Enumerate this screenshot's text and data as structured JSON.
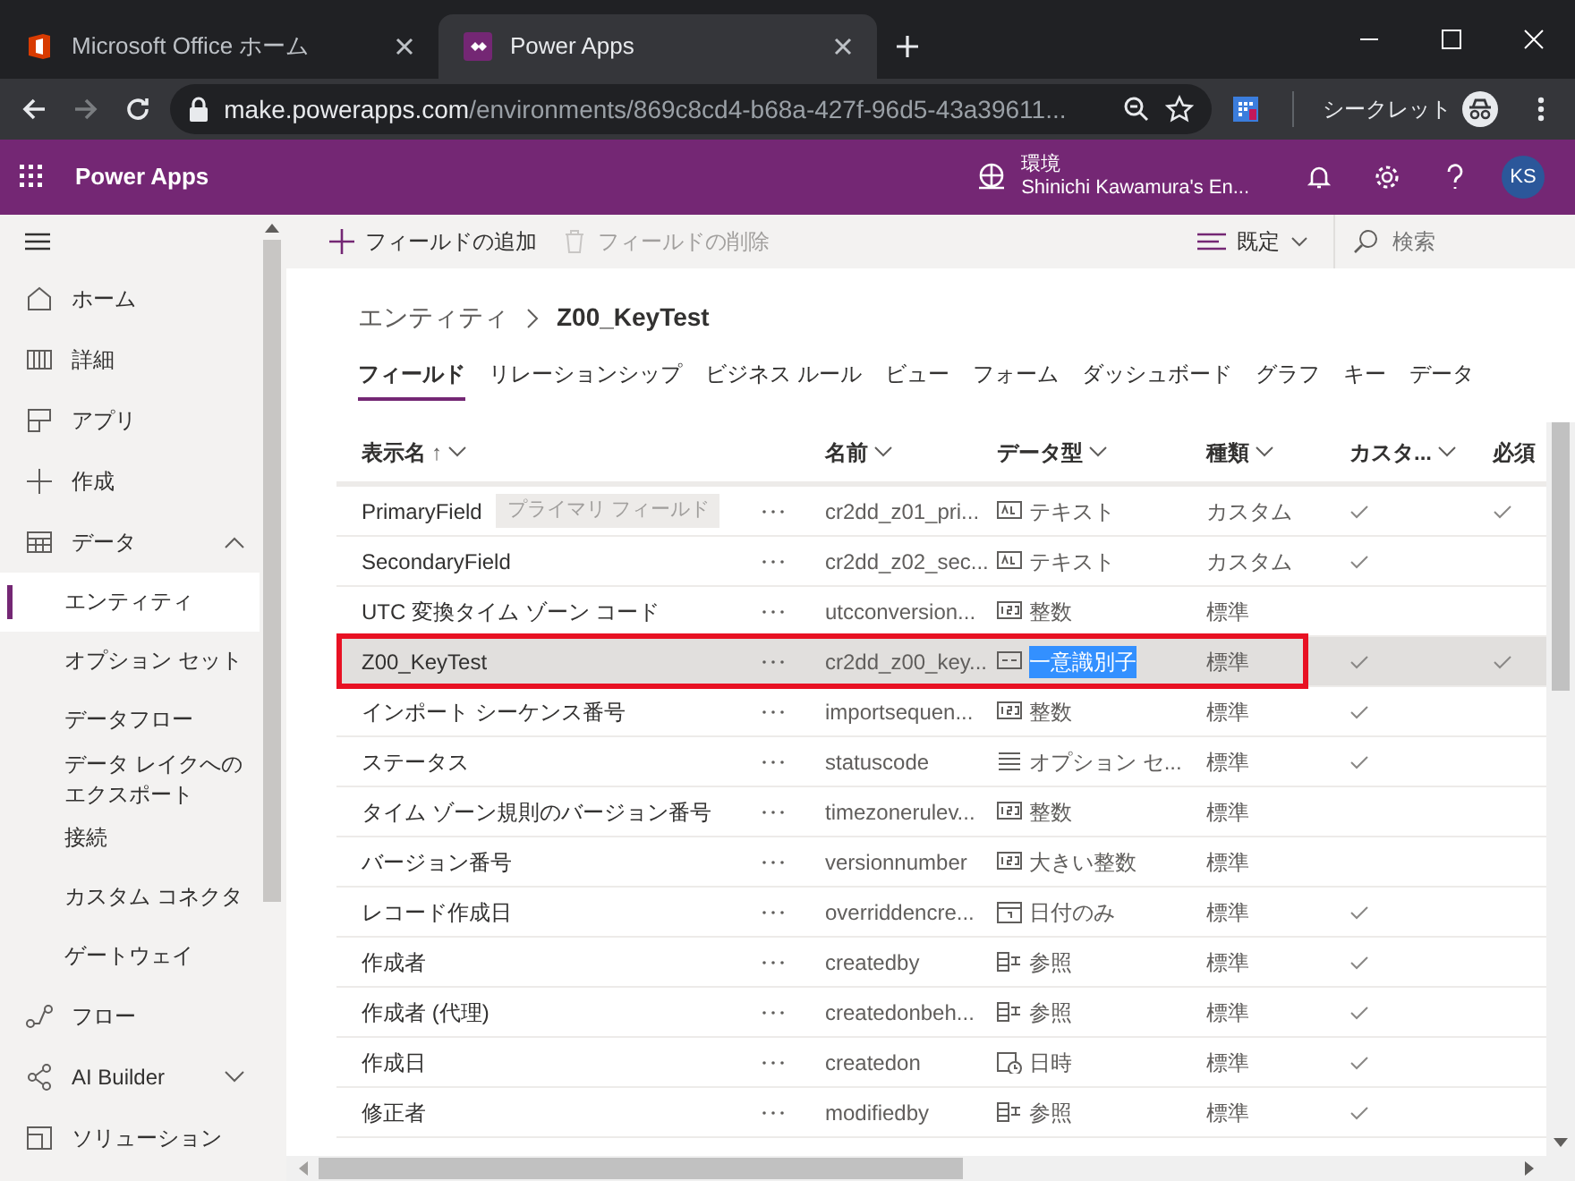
{
  "browser": {
    "tabs": [
      {
        "title": "Microsoft Office ホーム",
        "selected": false
      },
      {
        "title": "Power Apps",
        "selected": true
      }
    ],
    "url": {
      "host": "make.powerapps.com",
      "path": "/environments/869c8cd4-b68a-427f-96d5-43a39611..."
    },
    "incognito": "シークレット"
  },
  "app": {
    "title": "Power Apps",
    "environment_label": "環境",
    "environment_name": "Shinichi Kawamura's En...",
    "avatar": "KS"
  },
  "sidebar": {
    "items": [
      {
        "label": "ホーム"
      },
      {
        "label": "詳細"
      },
      {
        "label": "アプリ"
      },
      {
        "label": "作成"
      },
      {
        "label": "データ",
        "expanded": true,
        "children": [
          {
            "label": "エンティティ",
            "selected": true
          },
          {
            "label": "オプション セット",
            "selected": false
          },
          {
            "label": "データフロー",
            "selected": false
          },
          {
            "label": "データ レイクへのエクスポート",
            "selected": false
          },
          {
            "label": "接続",
            "selected": false
          },
          {
            "label": "カスタム コネクタ",
            "selected": false
          },
          {
            "label": "ゲートウェイ",
            "selected": false
          }
        ]
      },
      {
        "label": "フロー"
      },
      {
        "label": "AI Builder",
        "expanded": false
      },
      {
        "label": "ソリューション"
      }
    ]
  },
  "commands": [
    {
      "label": "フィールドの追加",
      "disabled": false
    },
    {
      "label": "フィールドの削除",
      "disabled": true
    }
  ],
  "view_menu": "既定",
  "search": {
    "placeholder": "検索"
  },
  "breadcrumb": [
    "エンティティ",
    "Z00_KeyTest"
  ],
  "tabs": [
    {
      "label": "フィールド",
      "selected": true
    },
    {
      "label": "リレーションシップ",
      "selected": false
    },
    {
      "label": "ビジネス ルール",
      "selected": false
    },
    {
      "label": "ビュー",
      "selected": false
    },
    {
      "label": "フォーム",
      "selected": false
    },
    {
      "label": "ダッシュボード",
      "selected": false
    },
    {
      "label": "グラフ",
      "selected": false
    },
    {
      "label": "キー",
      "selected": false
    },
    {
      "label": "データ",
      "selected": false
    }
  ],
  "table": {
    "columns": [
      {
        "label": "表示名",
        "sort_mark": "↑"
      },
      {
        "label": "名前"
      },
      {
        "label": "データ型"
      },
      {
        "label": "種類"
      },
      {
        "label": "カスタ..."
      },
      {
        "label": "必須"
      }
    ],
    "rows": [
      {
        "display_name": "PrimaryField",
        "badge": "プライマリ フィールド",
        "name": "cr2dd_z01_pri...",
        "kind": "text",
        "data_type": "テキスト",
        "field_type": "カスタム",
        "custom": true,
        "required": true,
        "selected": false,
        "highlighted": false
      },
      {
        "display_name": "SecondaryField",
        "name": "cr2dd_z02_sec...",
        "kind": "text",
        "data_type": "テキスト",
        "field_type": "カスタム",
        "custom": true,
        "required": false,
        "selected": false,
        "highlighted": false
      },
      {
        "display_name": "UTC 変換タイム ゾーン コード",
        "name": "utcconversion...",
        "kind": "number",
        "data_type": "整数",
        "field_type": "標準",
        "custom": false,
        "required": false,
        "selected": false,
        "highlighted": false
      },
      {
        "display_name": "Z00_KeyTest",
        "name": "cr2dd_z00_key...",
        "kind": "id",
        "data_type": "一意識別子",
        "data_type_text_selected": true,
        "field_type": "標準",
        "custom": true,
        "required": true,
        "selected": true,
        "highlighted": true
      },
      {
        "display_name": "インポート シーケンス番号",
        "name": "importsequen...",
        "kind": "number",
        "data_type": "整数",
        "field_type": "標準",
        "custom": true,
        "required": false,
        "selected": false,
        "highlighted": false
      },
      {
        "display_name": "ステータス",
        "name": "statuscode",
        "kind": "option",
        "data_type": "オプション セ...",
        "field_type": "標準",
        "custom": true,
        "required": false,
        "selected": false,
        "highlighted": false
      },
      {
        "display_name": "タイム ゾーン規則のバージョン番号",
        "name": "timezonerulev...",
        "kind": "number",
        "data_type": "整数",
        "field_type": "標準",
        "custom": false,
        "required": false,
        "selected": false,
        "highlighted": false
      },
      {
        "display_name": "バージョン番号",
        "name": "versionnumber",
        "kind": "number",
        "data_type": "大きい整数",
        "field_type": "標準",
        "custom": false,
        "required": false,
        "selected": false,
        "highlighted": false
      },
      {
        "display_name": "レコード作成日",
        "name": "overriddencre...",
        "kind": "date",
        "data_type": "日付のみ",
        "field_type": "標準",
        "custom": true,
        "required": false,
        "selected": false,
        "highlighted": false
      },
      {
        "display_name": "作成者",
        "name": "createdby",
        "kind": "lookup",
        "data_type": "参照",
        "field_type": "標準",
        "custom": true,
        "required": false,
        "selected": false,
        "highlighted": false
      },
      {
        "display_name": "作成者 (代理)",
        "name": "createdonbeh...",
        "kind": "lookup",
        "data_type": "参照",
        "field_type": "標準",
        "custom": true,
        "required": false,
        "selected": false,
        "highlighted": false
      },
      {
        "display_name": "作成日",
        "name": "createdon",
        "kind": "datetime",
        "data_type": "日時",
        "field_type": "標準",
        "custom": true,
        "required": false,
        "selected": false,
        "highlighted": false
      },
      {
        "display_name": "修正者",
        "name": "modifiedby",
        "kind": "lookup",
        "data_type": "参照",
        "field_type": "標準",
        "custom": true,
        "required": false,
        "selected": false,
        "highlighted": false
      }
    ]
  }
}
